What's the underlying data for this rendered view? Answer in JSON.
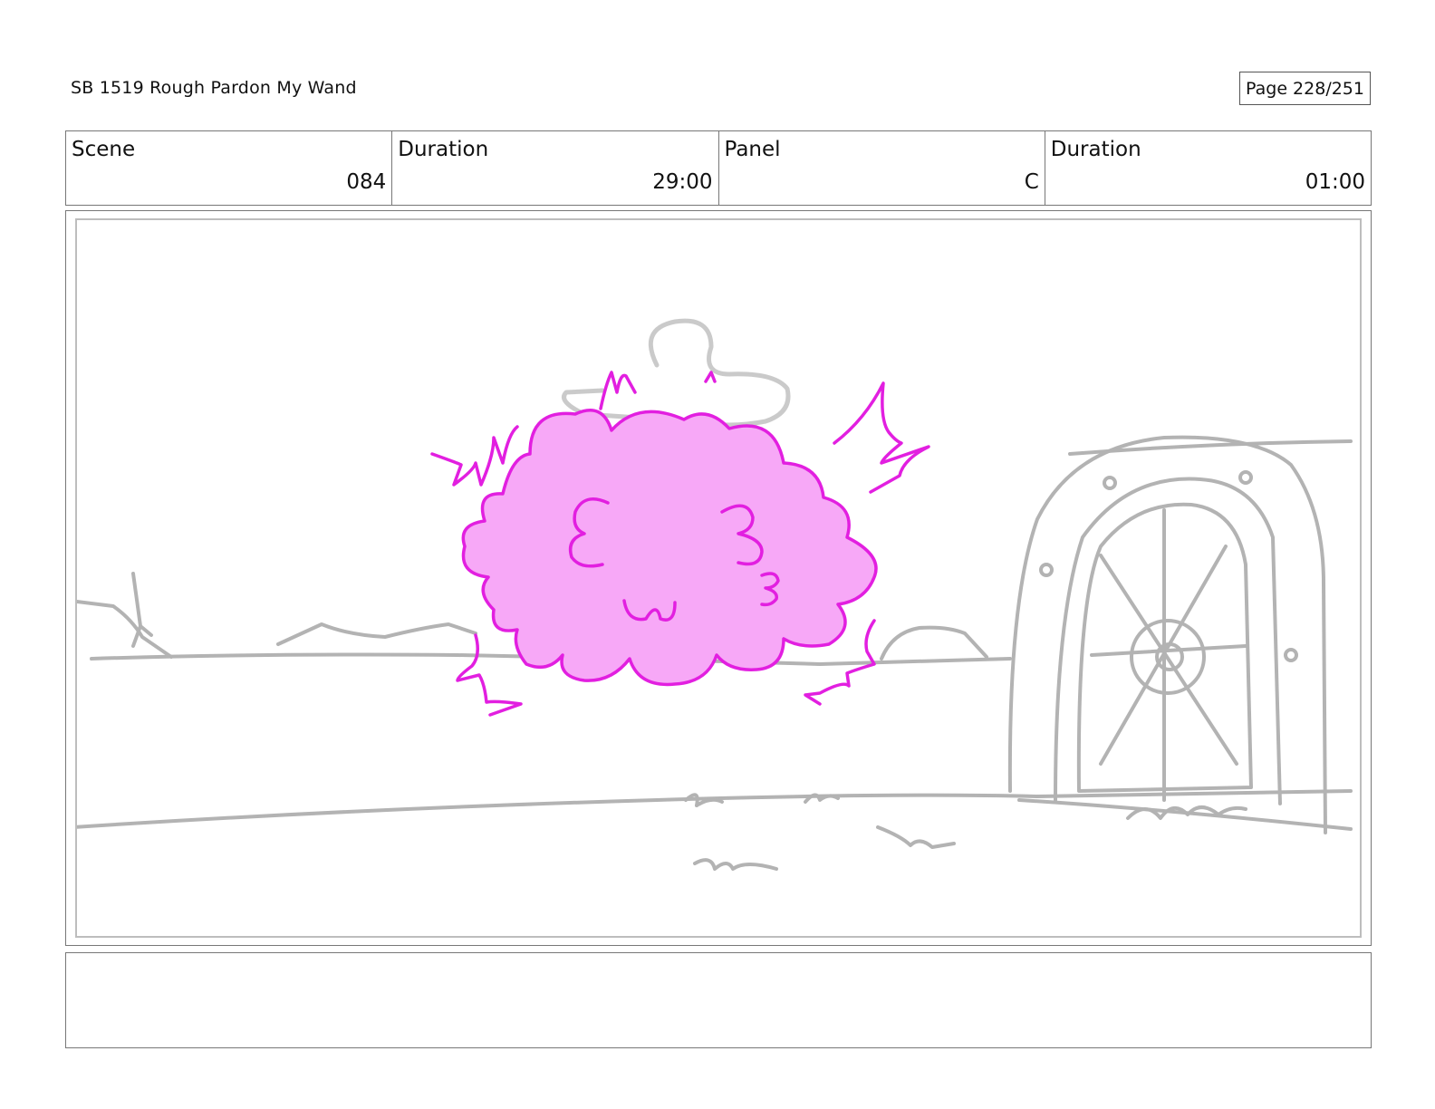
{
  "header": {
    "title": "SB 1519 Rough  Pardon My Wand",
    "page": "Page 228/251"
  },
  "info": {
    "scene_label": "Scene",
    "scene_value": "084",
    "scene_duration_label": "Duration",
    "scene_duration_value": "29:00",
    "panel_label": "Panel",
    "panel_value": "C",
    "panel_duration_label": "Duration",
    "panel_duration_value": "01:00"
  },
  "drawing": {
    "sketch_color": "#b3b3b3",
    "poof_fill": "#f7a8f7",
    "poof_stroke": "#e21fe0"
  },
  "notes": {
    "text": ""
  }
}
